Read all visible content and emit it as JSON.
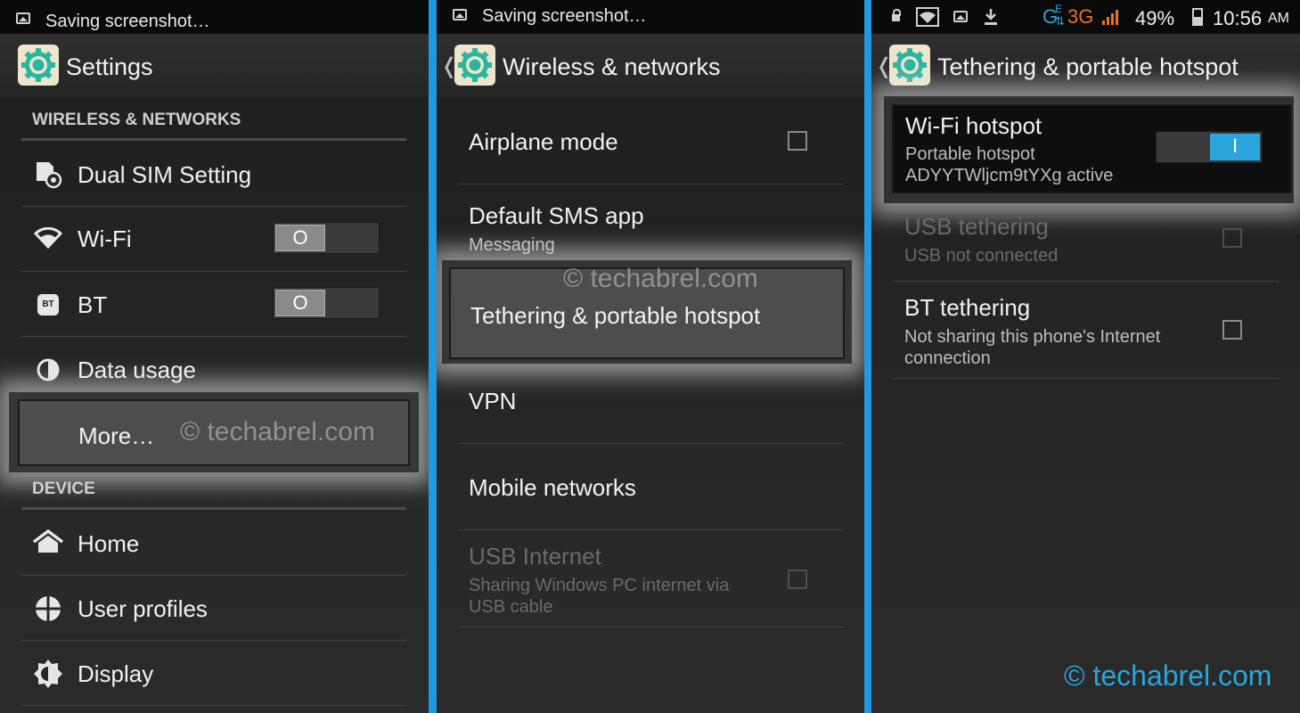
{
  "colors": {
    "divider_blue": "#1f9ae0",
    "accent": "#2aa6dd",
    "panel_bg": "#232323"
  },
  "panel1": {
    "status_text": "Saving screenshot…",
    "title": "Settings",
    "section_wireless": "WIRELESS & NETWORKS",
    "items": [
      {
        "label": "Dual SIM Setting",
        "icon": "dual-sim-icon"
      },
      {
        "label": "Wi-Fi",
        "icon": "wifi-icon",
        "toggle": "O"
      },
      {
        "label": "BT",
        "icon": "bluetooth-icon",
        "icon_text": "BT",
        "toggle": "O"
      },
      {
        "label": "Data usage",
        "icon": "data-usage-icon"
      },
      {
        "label": "More…",
        "highlighted": true
      }
    ],
    "section_device": "DEVICE",
    "device_items": [
      {
        "label": "Home",
        "icon": "home-icon"
      },
      {
        "label": "User profiles",
        "icon": "user-profiles-icon"
      },
      {
        "label": "Display",
        "icon": "display-icon"
      }
    ],
    "watermark": "© techabrel.com"
  },
  "panel2": {
    "status_text": "Saving screenshot…",
    "back": "❬",
    "title": "Wireless & networks",
    "items": [
      {
        "label": "Airplane mode",
        "checkbox": true
      },
      {
        "label": "Default SMS app",
        "sub": "Messaging"
      },
      {
        "label": "Tethering & portable hotspot",
        "highlighted": true
      },
      {
        "label": "VPN"
      },
      {
        "label": "Mobile networks"
      },
      {
        "label": "USB Internet",
        "sub": "Sharing Windows PC internet via USB cable",
        "disabled": true,
        "checkbox": true
      }
    ],
    "watermark": "© techabrel.com"
  },
  "panel3": {
    "status": {
      "network_g": "G",
      "network_e": "E",
      "network_3g": "3G",
      "battery": "49%",
      "time": "10:56",
      "ampm": "AM"
    },
    "back": "❬",
    "title": "Tethering & portable hotspot",
    "items": [
      {
        "label": "Wi-Fi hotspot",
        "sub1": "Portable hotspot",
        "sub2": "ADYYTWljcm9tYXg active",
        "toggle": "I",
        "highlighted": true
      },
      {
        "label": "USB tethering",
        "sub": "USB not connected",
        "disabled": true,
        "checkbox": true
      },
      {
        "label": "BT tethering",
        "sub1": "Not sharing this phone's Internet",
        "sub2": "connection",
        "checkbox": true
      }
    ],
    "watermark": "© techabrel.com"
  }
}
